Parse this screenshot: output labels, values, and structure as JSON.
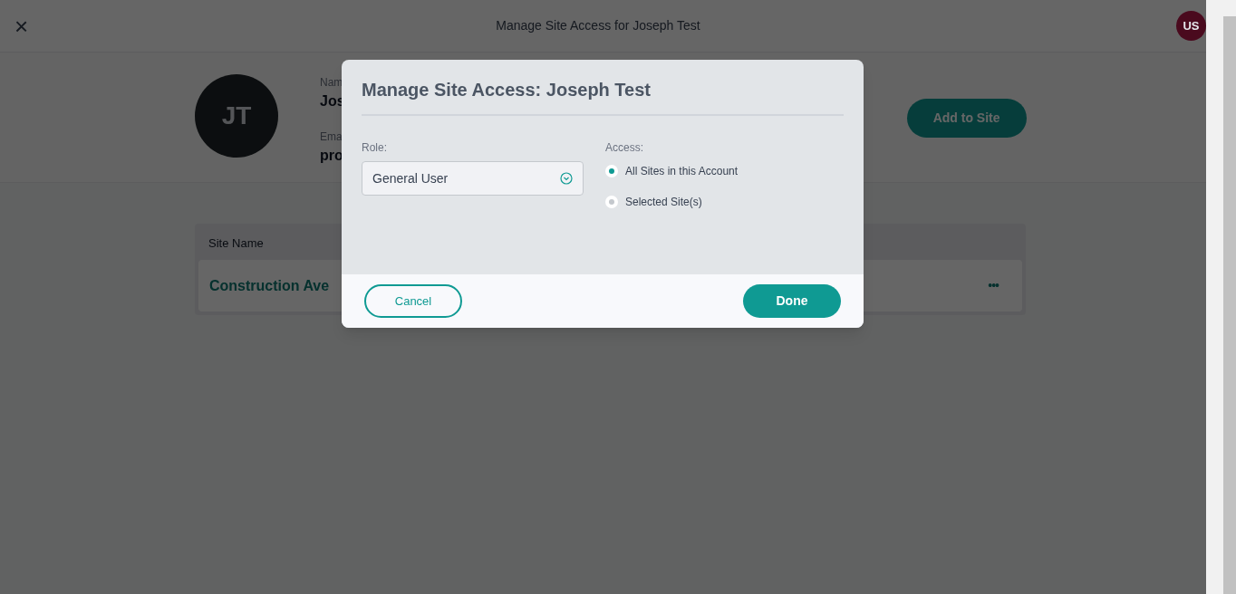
{
  "header": {
    "close_icon": "×",
    "title": "Manage Site Access for Joseph Test",
    "user_initials": "US"
  },
  "profile": {
    "initials": "JT",
    "name_label": "Nam",
    "name_value": "Jos",
    "email_label": "Ema",
    "email_value": "pro",
    "add_button": "Add to Site"
  },
  "sites_table": {
    "columns": [
      "Site Name"
    ],
    "rows": [
      {
        "site_name": "Construction Ave",
        "menu": "•••"
      }
    ]
  },
  "dialog": {
    "title": "Manage Site Access: Joseph Test",
    "role_label": "Role:",
    "role_value": "General User",
    "access_label": "Access:",
    "access_options": [
      {
        "label": "All Sites in this Account",
        "selected": true
      },
      {
        "label": "Selected Site(s)",
        "selected": false
      }
    ],
    "cancel_button": "Cancel",
    "done_button": "Done"
  }
}
